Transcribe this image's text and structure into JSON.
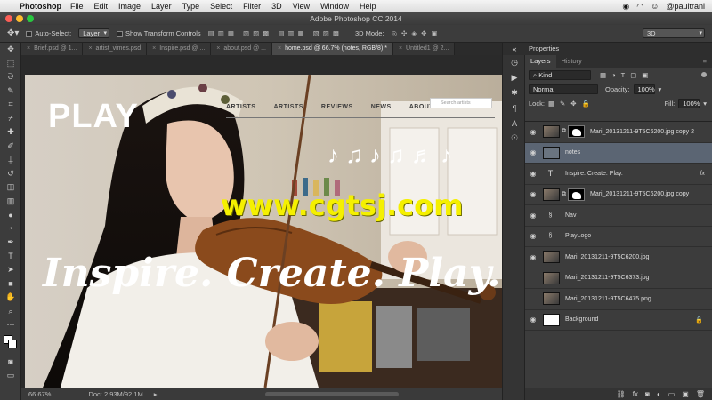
{
  "menubar": {
    "app_name": "Photoshop",
    "items": [
      "File",
      "Edit",
      "Image",
      "Layer",
      "Type",
      "Select",
      "Filter",
      "3D",
      "View",
      "Window",
      "Help"
    ],
    "user": "@paultrani"
  },
  "window": {
    "title": "Adobe Photoshop CC 2014"
  },
  "options": {
    "auto_select_label": "Auto-Select:",
    "auto_select_value": "Layer",
    "show_transform_label": "Show Transform Controls",
    "mode_label": "3D Mode:",
    "workspace_value": "3D"
  },
  "tabs": [
    {
      "label": "Brief.psd @ 1..."
    },
    {
      "label": "artist_vimes.psd"
    },
    {
      "label": "Inspire.psd @ ..."
    },
    {
      "label": "about.psd @ ..."
    },
    {
      "label": "home.psd @ 66.7% (notes, RGB/8) *",
      "active": true
    },
    {
      "label": "Untitled1 @ 2..."
    }
  ],
  "canvas": {
    "logo": "PLAY",
    "nav": [
      "ARTISTS",
      "ARTISTS",
      "REVIEWS",
      "NEWS",
      "ABOUT"
    ],
    "search_placeholder": "Search artists",
    "headline": "Inspire. Create. Play.",
    "watermark": "www.cgtsj.com",
    "notes_glyphs": "♪ ♫ ♪ ♫ ♬ ♪"
  },
  "status": {
    "zoom": "66.67%",
    "doc": "Doc: 2.93M/92.1M"
  },
  "panels": {
    "properties_tab": "Properties",
    "layers_tab": "Layers",
    "history_tab": "History",
    "filter_kind": "Kind",
    "blend_mode": "Normal",
    "opacity_label": "Opacity:",
    "opacity_value": "100%",
    "lock_label": "Lock:",
    "fill_label": "Fill:",
    "fill_value": "100%"
  },
  "layers": [
    {
      "name": "Mari_20131211-9T5C6200.jpg copy 2",
      "kind": "image-mask"
    },
    {
      "name": "notes",
      "kind": "image",
      "selected": true
    },
    {
      "name": "Inspire. Create. Play.",
      "kind": "text",
      "fx": "fx"
    },
    {
      "name": "Mari_20131211-9T5C6200.jpg copy",
      "kind": "image-mask"
    },
    {
      "name": "Nav",
      "kind": "link"
    },
    {
      "name": "PlayLogo",
      "kind": "link"
    },
    {
      "name": "Mari_20131211-9T5C6200.jpg",
      "kind": "image"
    },
    {
      "name": "Mari_20131211-9T5C6373.jpg",
      "kind": "image"
    },
    {
      "name": "Mari_20131211-9T5C6475.png",
      "kind": "image"
    },
    {
      "name": "Background",
      "kind": "background",
      "locked": true
    }
  ],
  "colors": {
    "accent_selection": "#5b6573",
    "watermark": "#f5f000"
  }
}
